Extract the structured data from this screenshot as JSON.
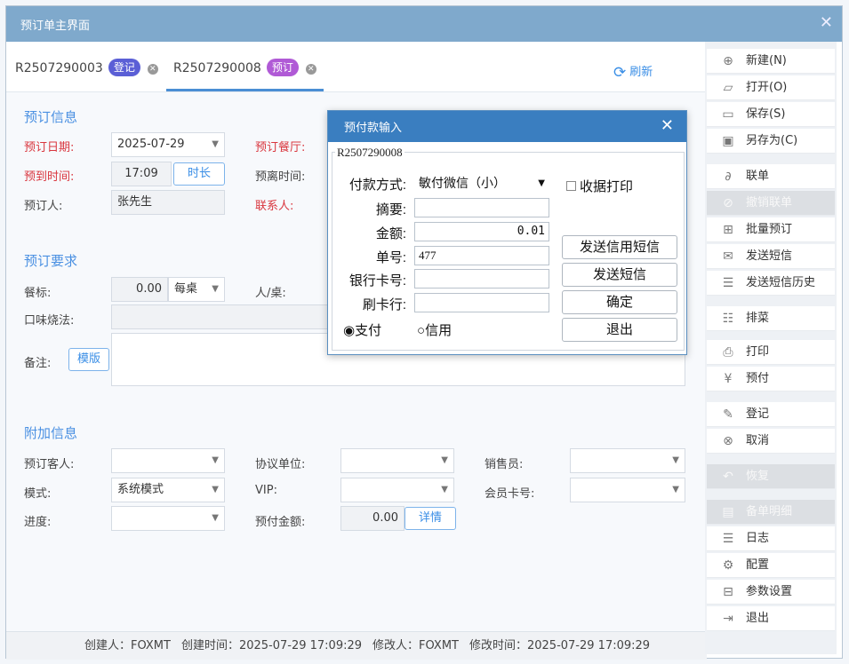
{
  "window": {
    "title": "预订单主界面"
  },
  "tabs": [
    {
      "label": "R2507290003",
      "badge": "登记",
      "badge_color": "#5b5fd6"
    },
    {
      "label": "R2507290008",
      "badge": "预订",
      "badge_color": "#b05ad6"
    }
  ],
  "refresh_label": "刷新",
  "booking_info": {
    "section": "预订信息",
    "date_label": "预订日期:",
    "date_value": "2025-07-29",
    "hall_label": "预订餐厅:",
    "arrive_label": "预到时间:",
    "arrive_value": "17:09",
    "duration_btn": "时长",
    "leave_label": "预离时间:",
    "booker_label": "预订人:",
    "booker_value": "张先生",
    "contact_label": "联系人:"
  },
  "requirements": {
    "section": "预订要求",
    "standard_label": "餐标:",
    "standard_value": "0.00",
    "standard_unit": "每桌",
    "per_table_label": "人/桌:",
    "taste_label": "口味烧法:",
    "remark_label": "备注:",
    "template_btn": "模版"
  },
  "extra": {
    "section": "附加信息",
    "guest_label": "预订客人:",
    "agreement_label": "协议单位:",
    "sales_label": "销售员:",
    "mode_label": "模式:",
    "mode_value": "系统模式",
    "vip_label": "VIP:",
    "card_label": "会员卡号:",
    "progress_label": "进度:",
    "deposit_label": "预付金额:",
    "deposit_value": "0.00",
    "detail_btn": "详情"
  },
  "footer": {
    "creator": "创建人：FOXMT",
    "created": "创建时间：2025-07-29 17:09:29",
    "modifier": "修改人：FOXMT",
    "modified": "修改时间：2025-07-29 17:09:29"
  },
  "sidebar": [
    {
      "label": "新建(N)",
      "icon": "plus-circle-icon",
      "enabled": true
    },
    {
      "label": "打开(O)",
      "icon": "folder-open-icon",
      "enabled": true
    },
    {
      "label": "保存(S)",
      "icon": "save-icon",
      "enabled": true
    },
    {
      "label": "另存为(C)",
      "icon": "save-as-icon",
      "enabled": true
    },
    {
      "label": "联单",
      "icon": "link-icon",
      "enabled": true
    },
    {
      "label": "撤销联单",
      "icon": "unlink-icon",
      "enabled": false
    },
    {
      "label": "批量预订",
      "icon": "batch-add-icon",
      "enabled": true
    },
    {
      "label": "发送短信",
      "icon": "mail-icon",
      "enabled": true
    },
    {
      "label": "发送短信历史",
      "icon": "history-icon",
      "enabled": true
    },
    {
      "label": "排菜",
      "icon": "menu-list-icon",
      "enabled": true
    },
    {
      "label": "打印",
      "icon": "print-icon",
      "enabled": true
    },
    {
      "label": "预付",
      "icon": "yen-icon",
      "enabled": true
    },
    {
      "label": "登记",
      "icon": "edit-icon",
      "enabled": true
    },
    {
      "label": "取消",
      "icon": "cancel-icon",
      "enabled": true
    },
    {
      "label": "恢复",
      "icon": "undo-icon",
      "enabled": false
    },
    {
      "label": "备单明细",
      "icon": "clipboard-icon",
      "enabled": false
    },
    {
      "label": "日志",
      "icon": "log-icon",
      "enabled": true
    },
    {
      "label": "配置",
      "icon": "gear-icon",
      "enabled": true
    },
    {
      "label": "参数设置",
      "icon": "params-icon",
      "enabled": true
    },
    {
      "label": "退出",
      "icon": "exit-icon",
      "enabled": true
    }
  ],
  "dialog": {
    "title": "预付款输入",
    "group_title": "R2507290008",
    "pay_method_label": "付款方式:",
    "pay_method_value": "敏付微信（小）",
    "receipt_print": "收据打印",
    "summary_label": "摘要:",
    "summary_value": "",
    "amount_label": "金额:",
    "amount_value": "0.01",
    "order_no_label": "单号:",
    "order_no_value": "477",
    "bank_card_label": "银行卡号:",
    "bank_card_value": "",
    "card_bank_label": "刷卡行:",
    "card_bank_value": "",
    "btn_credit_sms": "发送信用短信",
    "btn_sms": "发送短信",
    "btn_ok": "确定",
    "btn_exit": "退出",
    "radio_pay": "支付",
    "radio_credit": "信用",
    "selected_radio": "支付"
  }
}
